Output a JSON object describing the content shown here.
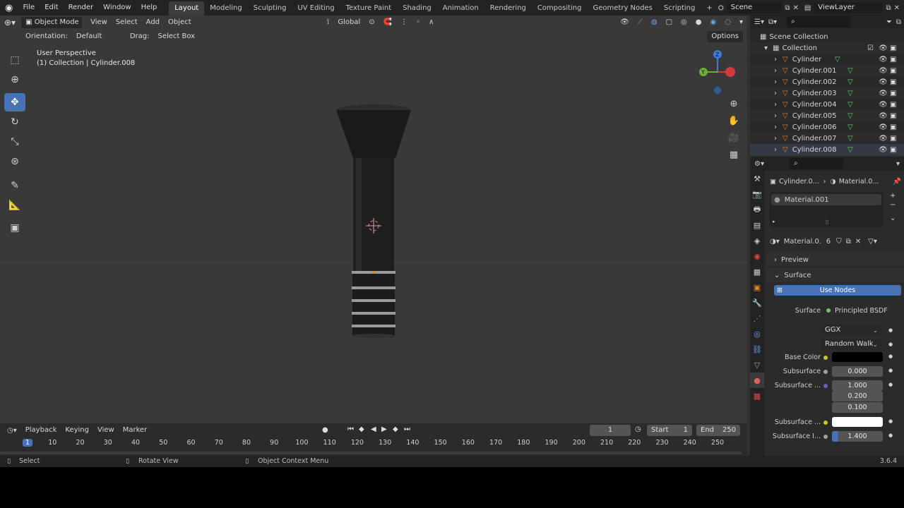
{
  "topbar": {
    "menus": [
      "File",
      "Edit",
      "Render",
      "Window",
      "Help"
    ],
    "workspaces": [
      "Layout",
      "Modeling",
      "Sculpting",
      "UV Editing",
      "Texture Paint",
      "Shading",
      "Animation",
      "Rendering",
      "Compositing",
      "Geometry Nodes",
      "Scripting"
    ],
    "active_workspace": "Layout",
    "add_tab": "+",
    "scene_name": "Scene",
    "view_layer": "ViewLayer"
  },
  "viewport_header": {
    "mode": "Object Mode",
    "menus": [
      "View",
      "Select",
      "Add",
      "Object"
    ],
    "transform_orientation": "Global",
    "orientation_label": "Orientation:",
    "orientation_value": "Default",
    "drag_label": "Drag:",
    "drag_value": "Select Box",
    "options": "Options"
  },
  "viewport": {
    "perspective": "User Perspective",
    "collection_info": "(1) Collection | Cylinder.008",
    "gizmo": {
      "x_color": "#d33b3b",
      "y_color": "#6ab03a",
      "z_color": "#3d7bd6",
      "y_label": "Y",
      "z_label": "Z"
    }
  },
  "toolbar": {
    "tools": [
      "select-box",
      "cursor",
      "move",
      "rotate",
      "scale",
      "transform",
      "annotate",
      "measure",
      "add-cube"
    ],
    "active": "move"
  },
  "outliner": {
    "search_placeholder": "",
    "scene_collection": "Scene Collection",
    "collection": "Collection",
    "objects": [
      "Cylinder",
      "Cylinder.001",
      "Cylinder.002",
      "Cylinder.003",
      "Cylinder.004",
      "Cylinder.005",
      "Cylinder.006",
      "Cylinder.007",
      "Cylinder.008"
    ]
  },
  "properties": {
    "breadcrumb_object": "Cylinder.0...",
    "breadcrumb_material": "Material.0...",
    "slot": "Material.001",
    "material_name": "Material.0...",
    "users": "6",
    "preview": "Preview",
    "surface_panel": "Surface",
    "use_nodes": "Use Nodes",
    "surface_label": "Surface",
    "surface_shader": "Principled BSDF",
    "distribution": "GGX",
    "subsurface_method": "Random Walk",
    "fields": {
      "base_color_label": "Base Color",
      "base_color": "#000000",
      "subsurface_label": "Subsurface",
      "subsurface": "0.000",
      "radius_label": "Subsurface ...",
      "radius": [
        "1.000",
        "0.200",
        "0.100"
      ],
      "sub_color_label": "Subsurface ...",
      "sub_color": "#ffffff",
      "ior_label": "Subsurface I...",
      "ior": "1.400"
    }
  },
  "timeline": {
    "menus": [
      "Playback",
      "Keying",
      "View",
      "Marker"
    ],
    "current_frame": "1",
    "start_label": "Start",
    "start": "1",
    "end_label": "End",
    "end": "250",
    "ticks": [
      "1",
      "10",
      "20",
      "30",
      "40",
      "50",
      "60",
      "70",
      "80",
      "90",
      "100",
      "110",
      "120",
      "130",
      "140",
      "150",
      "160",
      "170",
      "180",
      "190",
      "200",
      "210",
      "220",
      "230",
      "240",
      "250"
    ]
  },
  "statusbar": {
    "select": "Select",
    "rotate": "Rotate View",
    "context": "Object Context Menu",
    "version": "3.6.4"
  },
  "colors": {
    "accent": "#4772b3",
    "object_orange": "#e0822a",
    "mesh_green": "#6ec46a"
  }
}
